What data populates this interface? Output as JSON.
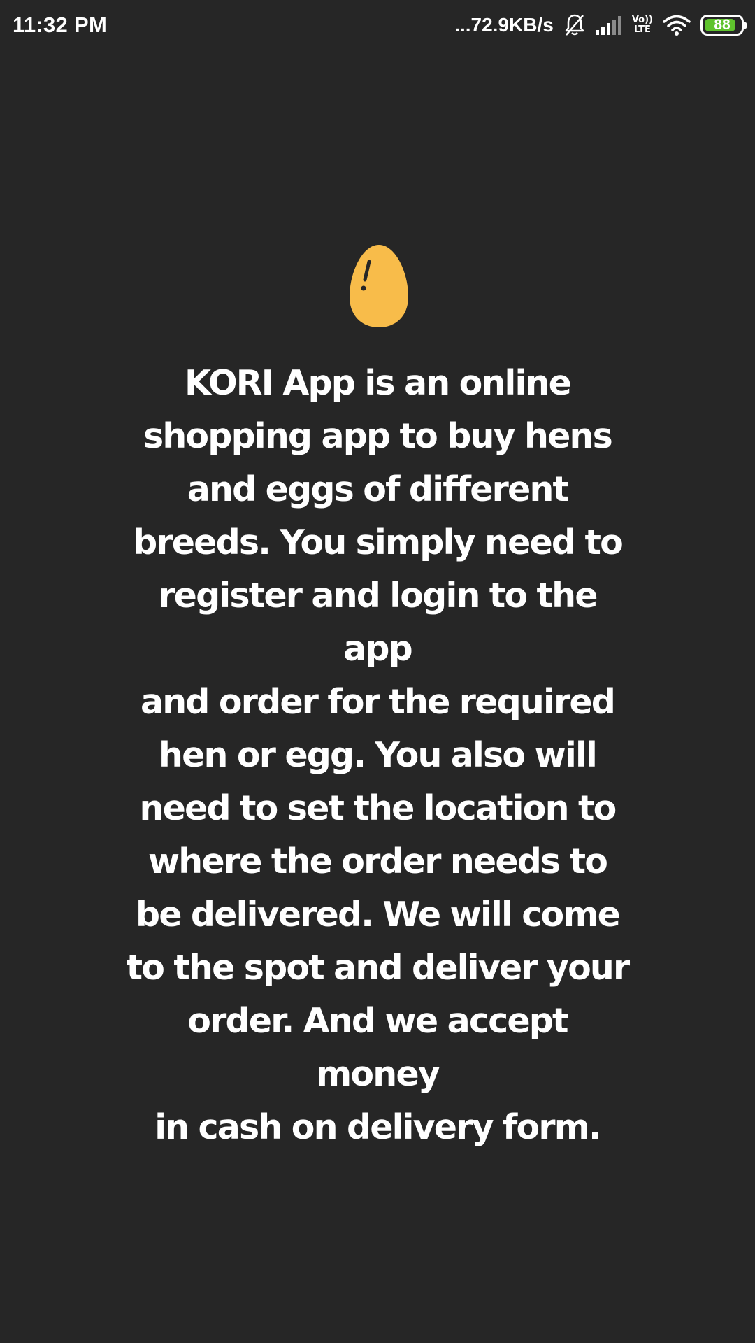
{
  "status_bar": {
    "time": "11:32 PM",
    "net_speed": "...72.9KB/s",
    "icons": [
      "bell-muted-icon",
      "signal-icon",
      "volte-icon",
      "wifi-icon",
      "battery-icon"
    ],
    "volte_top": "Vo))",
    "volte_bottom": "LTE",
    "battery_level": "88",
    "battery_fraction": 0.88,
    "battery_color": "#5fc32d"
  },
  "main": {
    "icon": "egg-icon",
    "egg_color": "#f8bc4a",
    "description": "KORI App is an online\nshopping app to buy hens\nand eggs of different\nbreeds. You simply need to\nregister and login to the app\nand order for the required\nhen or egg. You also will\nneed to set the location to\nwhere the order needs to\nbe delivered.  We will come\nto the spot and deliver your\norder. And we accept money\nin cash on delivery form."
  },
  "colors": {
    "background": "#262626",
    "text": "#ffffff"
  }
}
